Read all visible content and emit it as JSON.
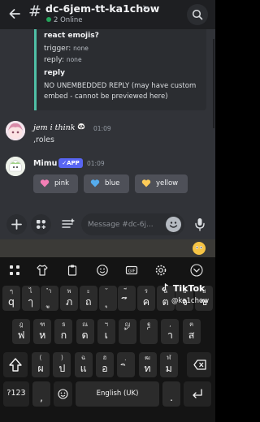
{
  "header": {
    "channel_name": "dc-6jem-tt-ka1chow",
    "online_text": "2 Online"
  },
  "embed": {
    "title": "react emojis?",
    "trigger_label": "trigger:",
    "trigger_value": "none",
    "reply_label": "reply:",
    "reply_value": "none",
    "reply_heading": "reply",
    "reply_body": "NO UNEMBEDDED REPLY (may have custom embed - cannot be previewed here)"
  },
  "messages": [
    {
      "author": "jem i think",
      "author_emoji": "🐼",
      "time": "01:09",
      "text": ",roles"
    },
    {
      "author": "Mimu",
      "badge": "✓APP",
      "time": "01:09"
    }
  ],
  "role_buttons": [
    {
      "label": "pink",
      "color": "#f47fb6"
    },
    {
      "label": "blue",
      "color": "#55acee"
    },
    {
      "label": "yellow",
      "color": "#fdcb58"
    }
  ],
  "composer": {
    "placeholder": "Message #dc-6j..."
  },
  "keyboard": {
    "row1": [
      {
        "main": "q",
        "sup": "ๆ"
      },
      {
        "main": "ๅ",
        "sup": "ไ"
      },
      {
        "main": "ู",
        "sup": "ำ"
      },
      {
        "main": "ภ",
        "sup": "พ"
      },
      {
        "main": "ถ",
        "sup": "ะ"
      },
      {
        "main": "ุ",
        "sup": "ั"
      },
      {
        "main": "ึ",
        "sup": "ี"
      },
      {
        "main": "ค",
        "sup": "ร"
      },
      {
        "main": "ต",
        "sup": "น"
      },
      {
        "main": "จ",
        "sup": "ย"
      },
      {
        "main": "ข",
        "sup": "บ"
      }
    ],
    "row2": [
      {
        "main": "ฟ",
        "sup": "ฎ"
      },
      {
        "main": "ห",
        "sup": "ฑ"
      },
      {
        "main": "ก",
        "sup": "ธ"
      },
      {
        "main": "ด",
        "sup": "ณ"
      },
      {
        "main": "เ",
        "sup": "ฯ"
      },
      {
        "main": "้",
        "sup": "ญ"
      },
      {
        "main": "่",
        "sup": "ฐ"
      },
      {
        "main": "า",
        "sup": ","
      },
      {
        "main": "ส",
        "sup": "ฅ"
      }
    ],
    "row3": [
      {
        "main": "ผ",
        "sup": "("
      },
      {
        "main": "ป",
        "sup": ")"
      },
      {
        "main": "แ",
        "sup": "ฉ"
      },
      {
        "main": "อ",
        "sup": "ฮ"
      },
      {
        "main": "ิ",
        "sup": "ฺ"
      },
      {
        "main": "ท",
        "sup": "ฒ"
      },
      {
        "main": "ม",
        "sup": "ฬ"
      }
    ],
    "symbols_key": "?123",
    "comma_key": ",",
    "space_label": "English (UK)",
    "period_key": ".",
    "watermark_brand": "TikTok",
    "watermark_user": "@ka1chow"
  }
}
